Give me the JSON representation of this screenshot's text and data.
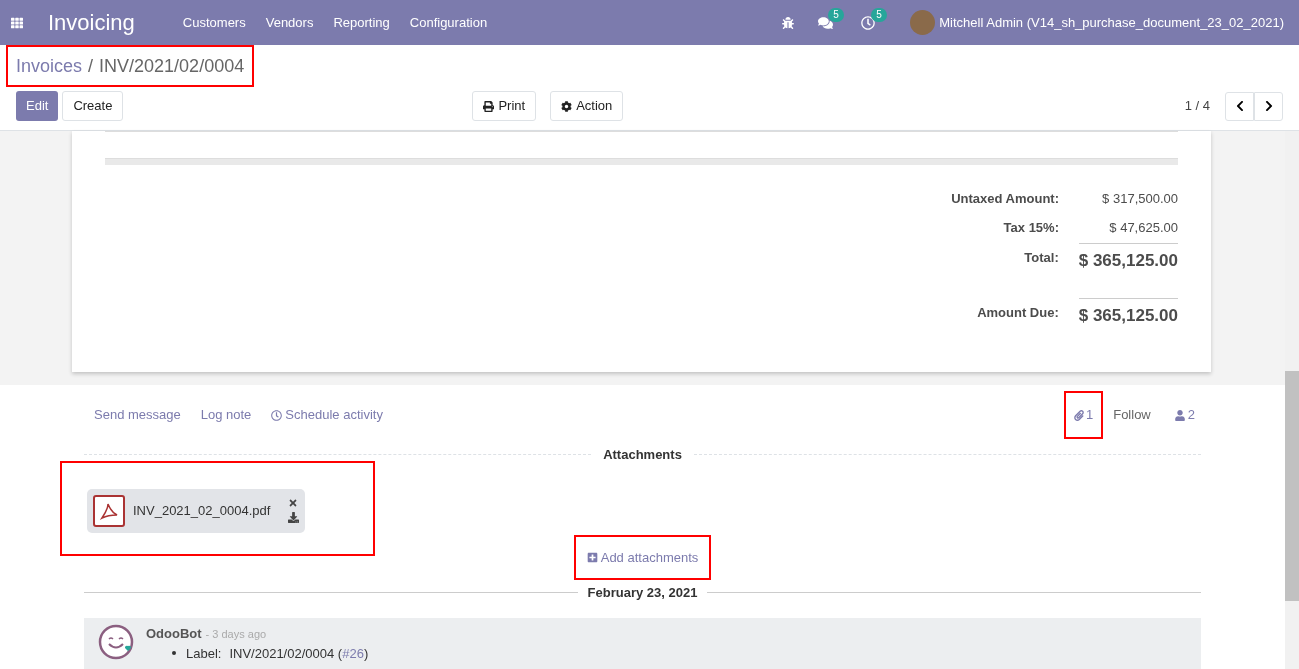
{
  "navbar": {
    "app_title": "Invoicing",
    "menus": [
      "Customers",
      "Vendors",
      "Reporting",
      "Configuration"
    ],
    "messages_count": "5",
    "activities_count": "5",
    "user": "Mitchell Admin (V14_sh_purchase_document_23_02_2021)"
  },
  "breadcrumb": {
    "parent": "Invoices",
    "separator": "/",
    "current": "INV/2021/02/0004",
    "highlighted": true
  },
  "buttons": [
    {
      "label": "Edit",
      "kind": "primary"
    },
    {
      "label": "Create",
      "kind": "secondary"
    }
  ],
  "center_buttons": [
    {
      "label": "Print",
      "kind": "print"
    },
    {
      "label": "Action",
      "kind": "gear"
    }
  ],
  "pager": {
    "text": "1 / 4"
  },
  "totals": [
    {
      "label": "Untaxed Amount:",
      "value": "$ 317,500.00",
      "kind": "plain"
    },
    {
      "label": "Tax 15%:",
      "value": "$ 47,625.00",
      "kind": "plain"
    },
    {
      "label": "Total:",
      "value": "$ 365,125.00",
      "kind": "grand"
    },
    {
      "label": "Amount Due:",
      "value": "$ 365,125.00",
      "kind": "due"
    }
  ],
  "chatter": {
    "actions": [
      {
        "label": "Send message",
        "kind": "plain"
      },
      {
        "label": "Log note",
        "kind": "plain"
      },
      {
        "label": "Schedule activity",
        "kind": "clock"
      }
    ],
    "attachment_count": "1",
    "attachment_count_highlighted": true,
    "follow": "Follow",
    "followers": "2",
    "attachments_title": "Attachments",
    "attachments": [
      {
        "name": "INV_2021_02_0004.pdf"
      }
    ],
    "attachments_highlighted": true,
    "add_attachments": "Add attachments",
    "add_highlighted": true,
    "date_separator": "February 23, 2021",
    "messages": [
      {
        "author": "OdooBot",
        "time": "- 3 days ago",
        "items": [
          {
            "label": "Label:",
            "value": "INV/2021/02/0004 (",
            "link": "#26",
            "tail": ")"
          }
        ]
      }
    ]
  }
}
